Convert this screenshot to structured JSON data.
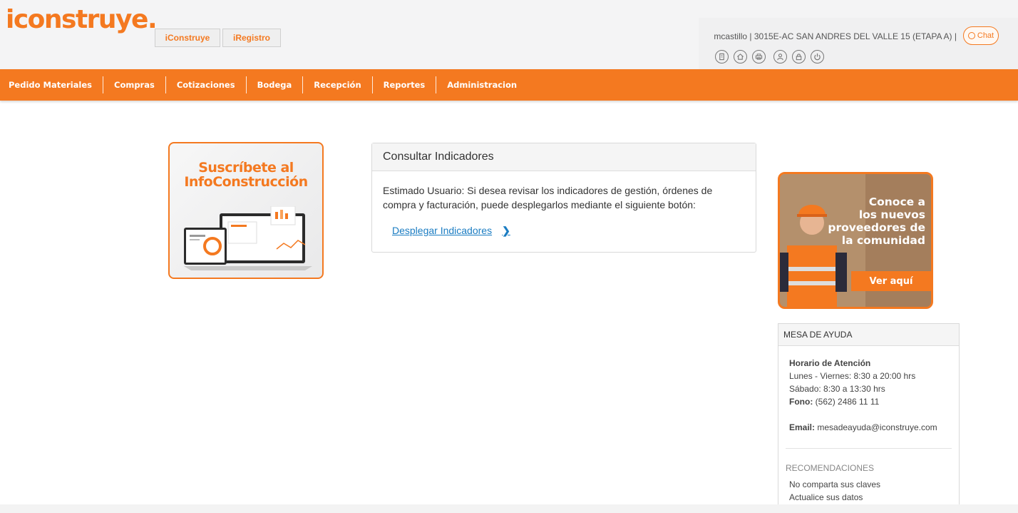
{
  "header": {
    "logo": "iconstruye.",
    "tabs": [
      "iConstruye",
      "iRegistro"
    ],
    "user_info": "mcastillo | 3015E-AC SAN ANDRES DEL VALLE 15 (ETAPA A) |",
    "chat_label": "Chat",
    "icons": [
      "building-icon",
      "home-icon",
      "printer-icon",
      "user-icon",
      "lock-icon",
      "power-icon"
    ]
  },
  "nav": {
    "items": [
      "Pedido Materiales",
      "Compras",
      "Cotizaciones",
      "Bodega",
      "Recepción",
      "Reportes",
      "Administracion"
    ]
  },
  "promo_left": {
    "headline_1": "Suscríbete al",
    "headline_2": "InfoConstrucción"
  },
  "indicators": {
    "title": "Consultar Indicadores",
    "body": "Estimado Usuario: Si desea revisar los indicadores de gestión, órdenes de compra y facturación, puede desplegarlos mediante el siguiente botón:",
    "link": "Desplegar Indicadores"
  },
  "promo_right": {
    "line1": "Conoce a",
    "line2": "los nuevos",
    "line3": "proveedores de",
    "line4": "la comunidad",
    "cta": "Ver aquí"
  },
  "help": {
    "title": "MESA DE AYUDA",
    "hours_title": "Horario de Atención",
    "weekdays": "Lunes - Viernes: 8:30 a 20:00 hrs",
    "saturday": "Sábado: 8:30 a 13:30 hrs",
    "phone_label": "Fono:",
    "phone": "(562) 2486 11 11",
    "email_label": "Email:",
    "email": "mesadeayuda@iconstruye.com",
    "rec_title": "RECOMENDACIONES",
    "rec_1": "No comparta sus claves",
    "rec_2": "Actualice sus datos"
  },
  "colors": {
    "brand_orange": "#f47920",
    "link_blue": "#1a7cc2"
  }
}
